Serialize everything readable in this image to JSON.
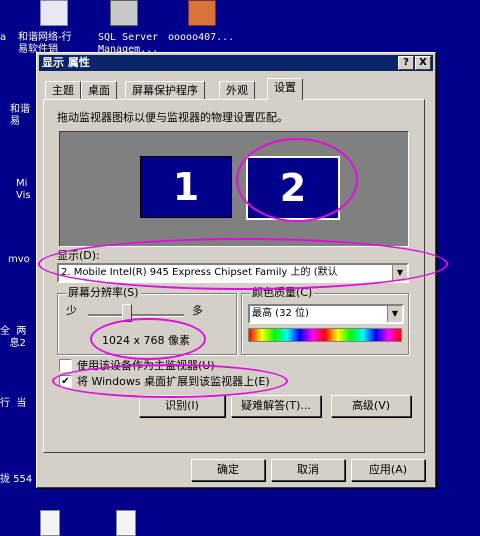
{
  "desktop": {
    "top_labels": [
      "和谐网络-行\n易软件销",
      "SQL Server\nManagem...",
      "ooooo407..."
    ],
    "left_labels": [
      "a",
      "和谐\n易",
      "Mi\nVis",
      "mvo",
      "全  两\n   息2",
      "行  当",
      "拢 554"
    ],
    "colors": {
      "desktop": "#00008a",
      "titlebar": "#0a246a",
      "highlight": "#e00fe0"
    }
  },
  "window": {
    "title": "显示 属性",
    "help_btn": "?",
    "close_btn": "X",
    "tabs": [
      "主题",
      "桌面",
      "屏幕保护程序",
      "外观",
      "设置"
    ],
    "active_tab": "设置",
    "instruction": "拖动监视器图标以便与监视器的物理设置匹配。",
    "monitors": [
      "1",
      "2"
    ],
    "display_label": "显示(D):",
    "display_value": "2. Mobile Intel(R) 945 Express Chipset Family 上的 (默认",
    "resolution_group": "屏幕分辨率(S)",
    "res_less": "少",
    "res_more": "多",
    "resolution_value": "1024 x 768 像素",
    "color_group": "颜色质量(C)",
    "color_value": "最高 (32 位)",
    "checkbox_primary": "使用该设备作为主监视器(U)",
    "checkbox_extend": "将 Windows 桌面扩展到该监视器上(E)",
    "checkbox_extend_checked": "✔",
    "btn_identify": "识别(I)",
    "btn_troubleshoot": "疑难解答(T)...",
    "btn_advanced": "高级(V)",
    "btn_ok": "确定",
    "btn_cancel": "取消",
    "btn_apply": "应用(A)"
  }
}
